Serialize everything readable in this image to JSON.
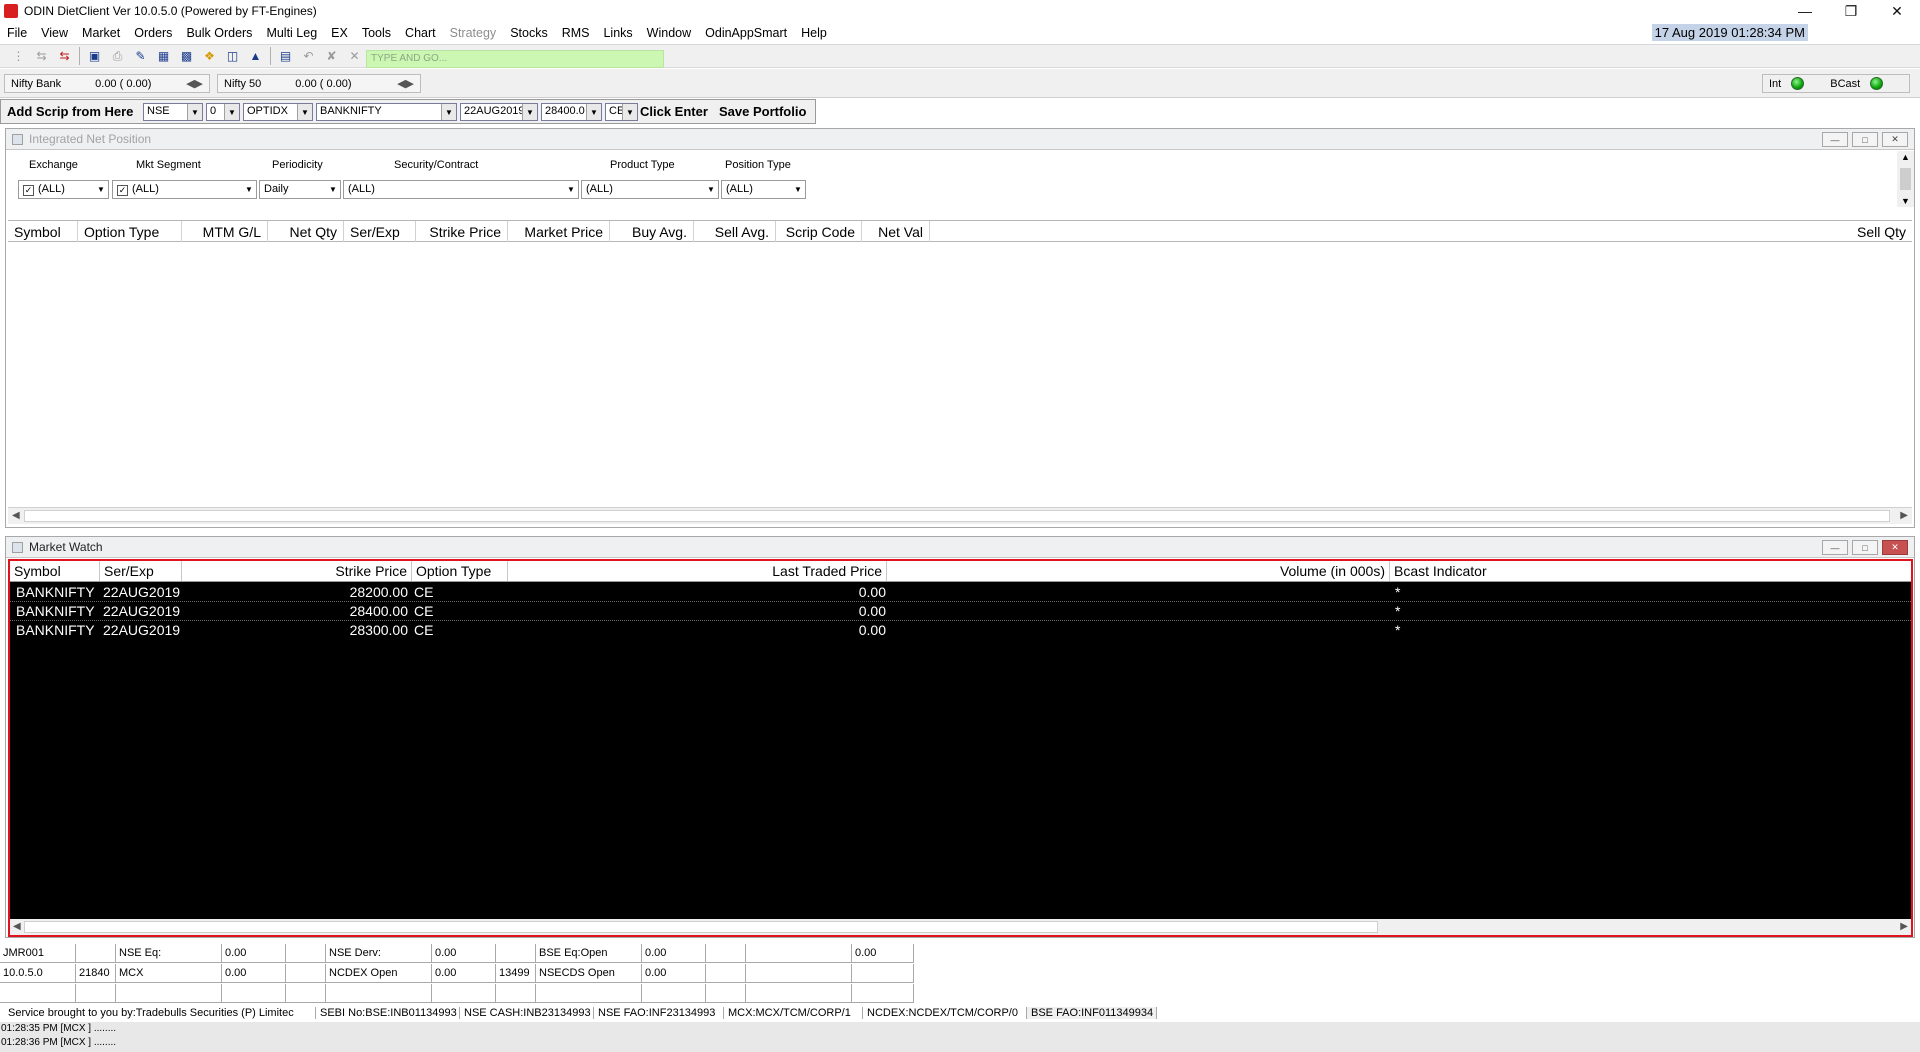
{
  "window": {
    "title": "ODIN DietClient Ver 10.0.5.0 (Powered by FT-Engines)",
    "datetime": "17 Aug 2019  01:28:34 PM"
  },
  "menu": [
    "File",
    "View",
    "Market",
    "Orders",
    "Bulk Orders",
    "Multi Leg",
    "EX",
    "Tools",
    "Chart",
    "Strategy",
    "Stocks",
    "RMS",
    "Links",
    "Window",
    "OdinAppSmart",
    "Help"
  ],
  "toolbar": {
    "search_placeholder": "TYPE AND GO..."
  },
  "indices": [
    {
      "name": "Nifty Bank",
      "value": "0.00 ( 0.00)"
    },
    {
      "name": "Nifty 50",
      "value": "0.00 ( 0.00)"
    }
  ],
  "connection": {
    "int_label": "Int",
    "bcast_label": "BCast"
  },
  "scrip_bar": {
    "label": "Add Scrip from Here",
    "exchange": "NSE",
    "segment": "0",
    "instrument": "OPTIDX",
    "symbol": "BANKNIFTY",
    "expiry": "22AUG2019",
    "strike": "28400.0",
    "option_type": "CE",
    "enter_label": "Click Enter",
    "save_label": "Save Portfolio"
  },
  "net_position": {
    "title": "Integrated Net Position",
    "filters": {
      "exchange_label": "Exchange",
      "exchange_value": "(ALL)",
      "segment_label": "Mkt Segment",
      "segment_value": "(ALL)",
      "periodicity_label": "Periodicity",
      "periodicity_value": "Daily",
      "security_label": "Security/Contract",
      "security_value": "(ALL)",
      "product_label": "Product Type",
      "product_value": "(ALL)",
      "position_label": "Position Type",
      "position_value": "(ALL)"
    },
    "columns": [
      "Symbol",
      "Option Type",
      "MTM G/L",
      "Net Qty",
      "Ser/Exp",
      "Strike Price",
      "Market Price",
      "Buy Avg.",
      "Sell Avg.",
      "Scrip Code",
      "Net Val",
      "Sell Qty"
    ]
  },
  "market_watch": {
    "title": "Market Watch",
    "columns": [
      "Symbol",
      "Ser/Exp",
      "Strike Price",
      "Option Type",
      "Last Traded Price",
      "Volume (in 000s)",
      "Bcast Indicator"
    ],
    "rows": [
      {
        "symbol": "BANKNIFTY",
        "ser_exp": "22AUG2019",
        "strike": "28200.00",
        "opt": "CE",
        "ltp": "0.00",
        "volume": "",
        "bcast": "*"
      },
      {
        "symbol": "BANKNIFTY",
        "ser_exp": "22AUG2019",
        "strike": "28400.00",
        "opt": "CE",
        "ltp": "0.00",
        "volume": "",
        "bcast": "*"
      },
      {
        "symbol": "BANKNIFTY",
        "ser_exp": "22AUG2019",
        "strike": "28300.00",
        "opt": "CE",
        "ltp": "0.00",
        "volume": "",
        "bcast": "*"
      }
    ]
  },
  "status": {
    "user_id": "JMR001",
    "version": "10.0.5.0",
    "code1": "21840",
    "mcx_label": "MCX",
    "mcx_value": "0.00",
    "nse_eq_label": "NSE Eq:",
    "nse_eq_value": "0.00",
    "nse_derv_label": "NSE Derv:",
    "nse_derv_value": "0.00",
    "ncdex_label": "NCDEX Open",
    "ncdex_value": "0.00",
    "code2": "13499",
    "bse_eq_label": "BSE Eq:Open",
    "bse_eq_value": "0.00",
    "nsecds_label": "NSECDS Open",
    "nsecds_value": "0.00",
    "extra_value": "0.00"
  },
  "footer": [
    "Service brought to you by:Tradebulls Securities (P) Limitec",
    "SEBI No:BSE:INB01134993",
    "NSE CASH:INB23134993",
    "NSE FAO:INF23134993",
    "MCX:MCX/TCM/CORP/1",
    "NCDEX:NCDEX/TCM/CORP/0",
    "BSE FAO:INF011349934"
  ],
  "logs": [
    "01:28:35 PM [MCX ] ........",
    "01:28:36 PM [MCX ] ........"
  ]
}
